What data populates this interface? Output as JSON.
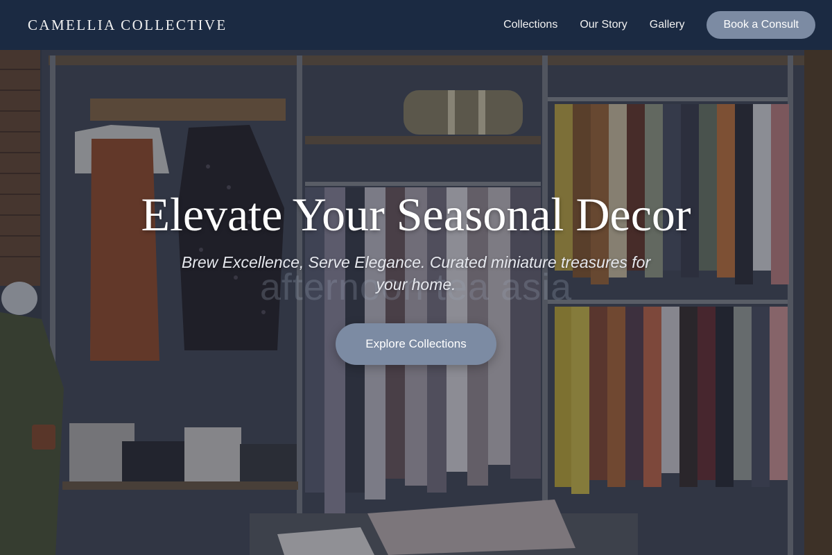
{
  "header": {
    "brand": "CAMELLIA COLLECTIVE",
    "nav": [
      {
        "label": "Collections"
      },
      {
        "label": "Our Story"
      },
      {
        "label": "Gallery"
      }
    ],
    "cta_label": "Book a Consult"
  },
  "hero": {
    "title": "Elevate Your Seasonal Decor",
    "subtitle": "Brew Excellence, Serve Elegance. Curated miniature treasures for your home.",
    "watermark": "afternoon tea asia",
    "button_label": "Explore Collections",
    "background_image": "clothing-boutique-photo"
  },
  "colors": {
    "header_bg": "#1b2a42",
    "accent_button": "#7c8ba3",
    "text_light": "#ffffff"
  }
}
